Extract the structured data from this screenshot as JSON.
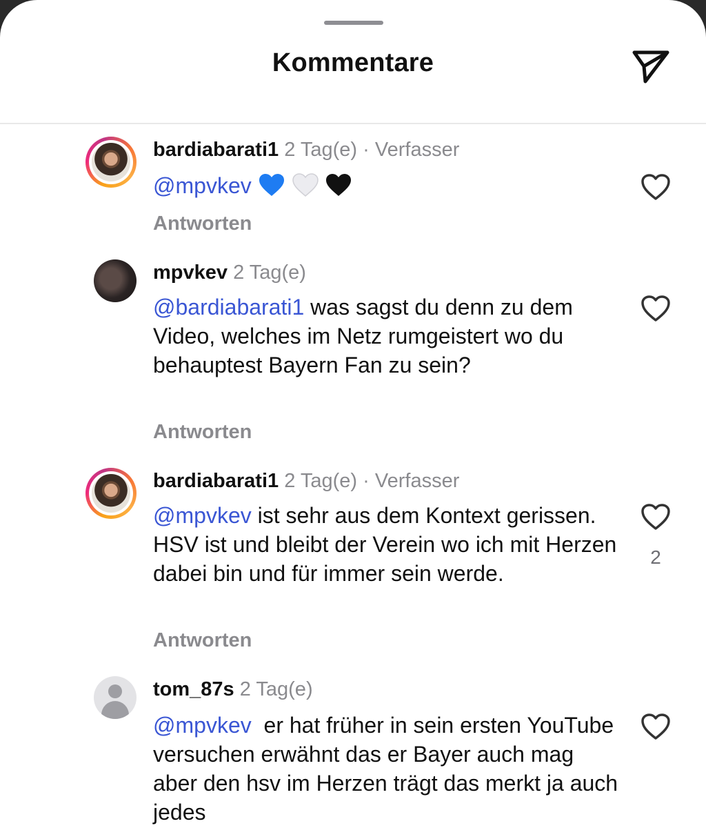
{
  "header": {
    "title": "Kommentare"
  },
  "icons": {
    "share": "paper-plane-icon",
    "like": "heart-outline-icon"
  },
  "colors": {
    "mention": "#3a56d4",
    "meta": "#8a8a8e",
    "heart_blue": "#1e7cf2",
    "heart_white": "#e9e9ee",
    "heart_black": "#111111"
  },
  "comments": [
    {
      "username": "bardiabarati1",
      "time": "2 Tag(e)",
      "author_tag": "· Verfasser",
      "mention": "@mpvkev",
      "text": "",
      "emojis": [
        "blue-heart-icon",
        "white-heart-icon",
        "black-heart-icon"
      ],
      "reply_label": "Antworten",
      "likes": ""
    },
    {
      "username": "mpvkev",
      "time": "2 Tag(e)",
      "mention": "@bardiabarati1",
      "text": " was sagst du denn zu dem Video, welches im Netz rumgeistert wo du behauptest Bayern Fan zu sein?",
      "reply_label": "Antworten",
      "likes": ""
    },
    {
      "username": "bardiabarati1",
      "time": "2 Tag(e)",
      "author_tag": "· Verfasser",
      "mention": "@mpvkev",
      "text": " ist sehr aus dem Kontext gerissen. HSV ist und bleibt der Verein wo ich mit Herzen dabei bin und für immer sein werde.",
      "reply_label": "Antworten",
      "likes": "2"
    },
    {
      "username": "tom_87s",
      "time": "2 Tag(e)",
      "mention": "@mpvkev",
      "text": "  er hat früher in sein ersten YouTube versuchen erwähnt das er Bayer auch mag aber den hsv im Herzen trägt das merkt ja auch jedes",
      "reply_label": "",
      "likes": ""
    }
  ]
}
